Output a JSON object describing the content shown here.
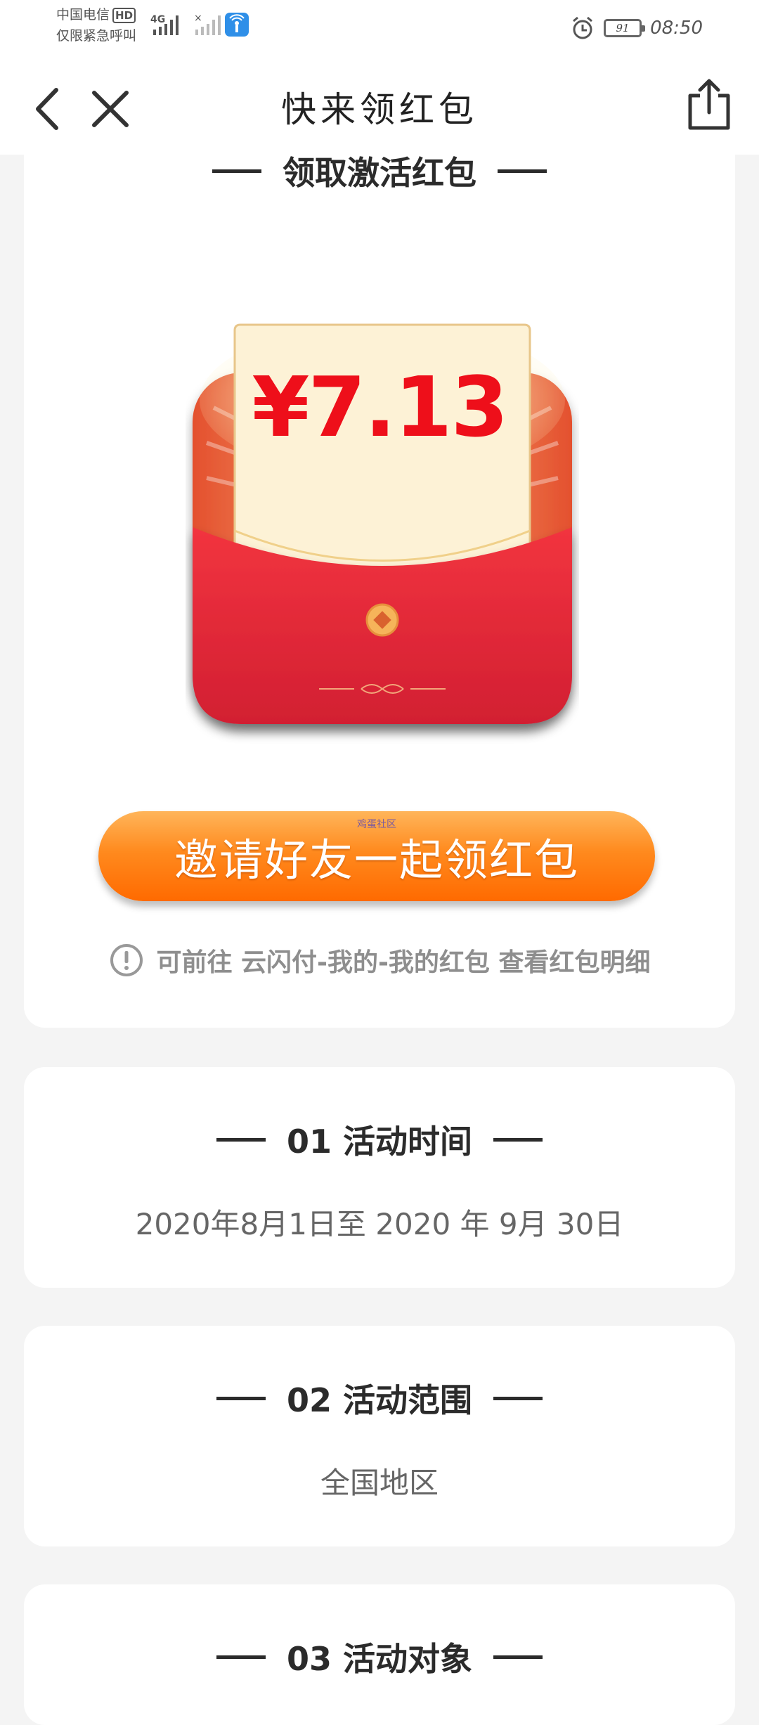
{
  "status_bar": {
    "carrier_line1": "中国电信",
    "carrier_hd": "HD",
    "carrier_line2": "仅限紧急呼叫",
    "network": "4G",
    "battery_level": "91",
    "time": "08:50"
  },
  "nav": {
    "title": "快来领红包"
  },
  "activate": {
    "heading": "领取激活红包",
    "amount": "¥7.13",
    "invite_button": "邀请好友一起领红包",
    "invite_watermark": "鸡蛋社区",
    "tip": "可前往 云闪付-我的-我的红包 查看红包明细"
  },
  "sections": [
    {
      "heading": "01 活动时间",
      "body": "2020年8月1日至 2020 年 9月 30日"
    },
    {
      "heading": "02 活动范围",
      "body": "全国地区"
    },
    {
      "heading": "03 活动对象"
    }
  ],
  "colors": {
    "amount_red": "#ee0f1a",
    "envelope_red": "#e8283a",
    "button_orange": "#ff7a10",
    "page_bg": "#f4f4f4"
  }
}
